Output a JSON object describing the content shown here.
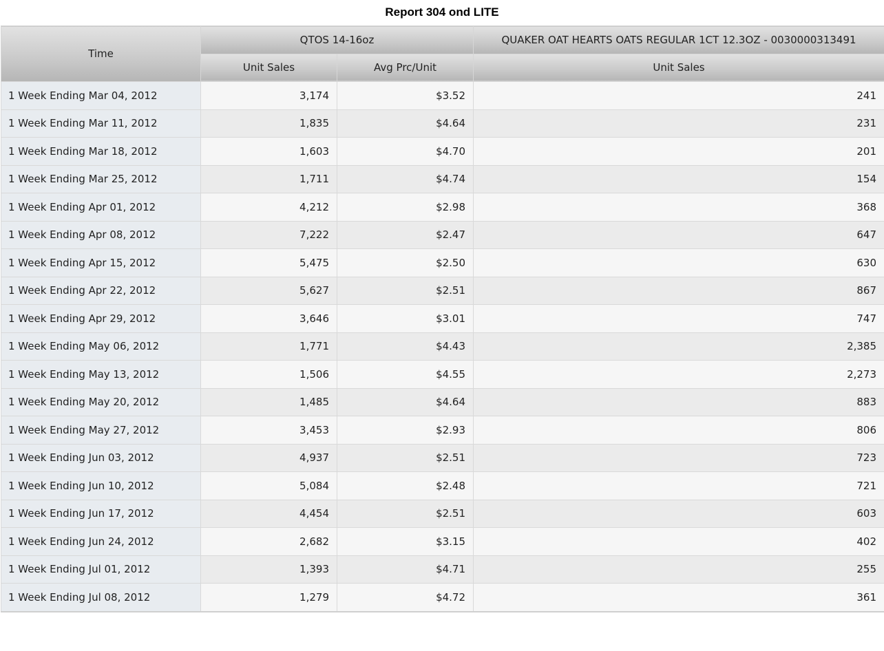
{
  "report": {
    "title": "Report 304 ond LITE"
  },
  "table": {
    "time_header": "Time",
    "group1_header": "QTOS 14-16oz",
    "group2_header": "QUAKER OAT HEARTS OATS REGULAR 1CT 12.3OZ - 0030000313491",
    "col_unit_sales_1": "Unit Sales",
    "col_avg_prc": "Avg Prc/Unit",
    "col_unit_sales_2": "Unit Sales",
    "rows": [
      {
        "time": "1 Week Ending Mar 04, 2012",
        "unit_sales_1": "3,174",
        "avg_prc": "$3.52",
        "unit_sales_2": "241"
      },
      {
        "time": "1 Week Ending Mar 11, 2012",
        "unit_sales_1": "1,835",
        "avg_prc": "$4.64",
        "unit_sales_2": "231"
      },
      {
        "time": "1 Week Ending Mar 18, 2012",
        "unit_sales_1": "1,603",
        "avg_prc": "$4.70",
        "unit_sales_2": "201"
      },
      {
        "time": "1 Week Ending Mar 25, 2012",
        "unit_sales_1": "1,711",
        "avg_prc": "$4.74",
        "unit_sales_2": "154"
      },
      {
        "time": "1 Week Ending Apr 01, 2012",
        "unit_sales_1": "4,212",
        "avg_prc": "$2.98",
        "unit_sales_2": "368"
      },
      {
        "time": "1 Week Ending Apr 08, 2012",
        "unit_sales_1": "7,222",
        "avg_prc": "$2.47",
        "unit_sales_2": "647"
      },
      {
        "time": "1 Week Ending Apr 15, 2012",
        "unit_sales_1": "5,475",
        "avg_prc": "$2.50",
        "unit_sales_2": "630"
      },
      {
        "time": "1 Week Ending Apr 22, 2012",
        "unit_sales_1": "5,627",
        "avg_prc": "$2.51",
        "unit_sales_2": "867"
      },
      {
        "time": "1 Week Ending Apr 29, 2012",
        "unit_sales_1": "3,646",
        "avg_prc": "$3.01",
        "unit_sales_2": "747"
      },
      {
        "time": "1 Week Ending May 06, 2012",
        "unit_sales_1": "1,771",
        "avg_prc": "$4.43",
        "unit_sales_2": "2,385"
      },
      {
        "time": "1 Week Ending May 13, 2012",
        "unit_sales_1": "1,506",
        "avg_prc": "$4.55",
        "unit_sales_2": "2,273"
      },
      {
        "time": "1 Week Ending May 20, 2012",
        "unit_sales_1": "1,485",
        "avg_prc": "$4.64",
        "unit_sales_2": "883"
      },
      {
        "time": "1 Week Ending May 27, 2012",
        "unit_sales_1": "3,453",
        "avg_prc": "$2.93",
        "unit_sales_2": "806"
      },
      {
        "time": "1 Week Ending Jun 03, 2012",
        "unit_sales_1": "4,937",
        "avg_prc": "$2.51",
        "unit_sales_2": "723"
      },
      {
        "time": "1 Week Ending Jun 10, 2012",
        "unit_sales_1": "5,084",
        "avg_prc": "$2.48",
        "unit_sales_2": "721"
      },
      {
        "time": "1 Week Ending Jun 17, 2012",
        "unit_sales_1": "4,454",
        "avg_prc": "$2.51",
        "unit_sales_2": "603"
      },
      {
        "time": "1 Week Ending Jun 24, 2012",
        "unit_sales_1": "2,682",
        "avg_prc": "$3.15",
        "unit_sales_2": "402"
      },
      {
        "time": "1 Week Ending Jul 01, 2012",
        "unit_sales_1": "1,393",
        "avg_prc": "$4.71",
        "unit_sales_2": "255"
      },
      {
        "time": "1 Week Ending Jul 08, 2012",
        "unit_sales_1": "1,279",
        "avg_prc": "$4.72",
        "unit_sales_2": "361"
      }
    ]
  },
  "colors": {
    "header_gradient_top": "#e2e2e2",
    "header_gradient_bottom": "#b5b5b5",
    "time_column_bg": "#e8ecf0",
    "row_light": "#f6f6f6",
    "row_dark": "#ebebeb"
  }
}
